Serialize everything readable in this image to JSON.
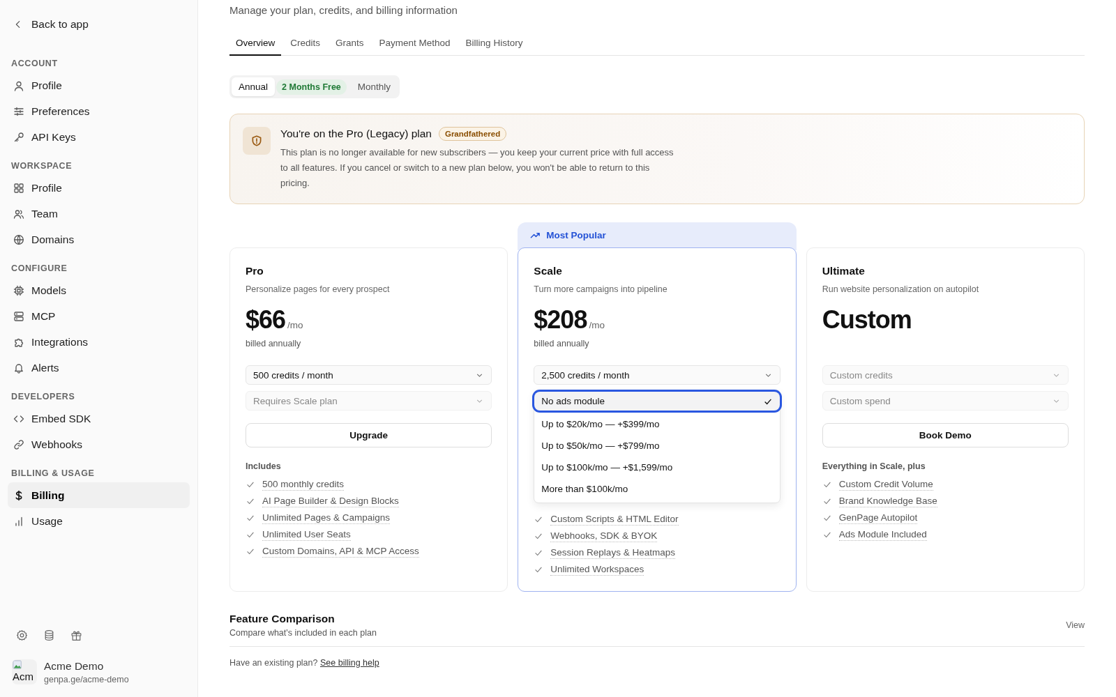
{
  "sidebar": {
    "back_link": "Back to app",
    "sections": [
      {
        "title": "ACCOUNT",
        "items": [
          {
            "label": "Profile",
            "selected": false
          },
          {
            "label": "Preferences",
            "selected": false
          },
          {
            "label": "API Keys",
            "selected": false
          }
        ]
      },
      {
        "title": "WORKSPACE",
        "items": [
          {
            "label": "Profile",
            "selected": false
          },
          {
            "label": "Team",
            "selected": false
          },
          {
            "label": "Domains",
            "selected": false
          }
        ]
      },
      {
        "title": "CONFIGURE",
        "items": [
          {
            "label": "Models",
            "selected": false
          },
          {
            "label": "MCP",
            "selected": false
          },
          {
            "label": "Integrations",
            "selected": false
          },
          {
            "label": "Alerts",
            "selected": false
          }
        ]
      },
      {
        "title": "DEVELOPERS",
        "items": [
          {
            "label": "Embed SDK",
            "selected": false
          },
          {
            "label": "Webhooks",
            "selected": false
          }
        ]
      },
      {
        "title": "BILLING & USAGE",
        "items": [
          {
            "label": "Billing",
            "selected": true
          },
          {
            "label": "Usage",
            "selected": false
          }
        ]
      }
    ],
    "account": {
      "avatar_alt": "Acm",
      "name": "Acme Demo",
      "url": "genpa.ge/acme-demo"
    }
  },
  "page": {
    "subtitle": "Manage your plan, credits, and billing information",
    "tabs": [
      {
        "label": "Overview",
        "selected": true
      },
      {
        "label": "Credits",
        "selected": false
      },
      {
        "label": "Grants",
        "selected": false
      },
      {
        "label": "Payment Method",
        "selected": false
      },
      {
        "label": "Billing History",
        "selected": false
      }
    ],
    "billing_toggle": [
      {
        "label": "Annual",
        "selected": true,
        "badge": "2 Months Free"
      },
      {
        "label": "Monthly",
        "selected": false
      }
    ],
    "notice": {
      "title": "You're on the Pro (Legacy) plan",
      "badge": "Grandfathered",
      "text": "This plan is no longer available for new subscribers — you keep your current price with full access to all features. If you cancel or switch to a new plan below, you won't be able to return to this pricing."
    },
    "plans": [
      {
        "name": "Pro",
        "tagline": "Personalize pages for every prospect",
        "price": "$66",
        "period": "/mo",
        "billing_note": "billed annually",
        "highlighted": false,
        "selects": [
          {
            "value": "500 credits / month",
            "disabled": false
          },
          {
            "placeholder": "Requires Scale plan",
            "disabled": true
          }
        ],
        "button": "Upgrade",
        "includes_title": "Includes",
        "features": [
          "500 monthly credits",
          "AI Page Builder & Design Blocks",
          "Unlimited Pages & Campaigns",
          "Unlimited User Seats",
          "Custom Domains, API & MCP Access"
        ]
      },
      {
        "name": "Scale",
        "tagline": "Turn more campaigns into pipeline",
        "price": "$208",
        "period": "/mo",
        "billing_note": "billed annually",
        "highlighted": true,
        "popular_label": "Most Popular",
        "selects": [
          {
            "value": "2,500 credits / month",
            "disabled": false
          }
        ],
        "menu": [
          {
            "label": "No ads module",
            "selected": true
          },
          {
            "label": "Up to $20k/mo — +$399/mo",
            "selected": false
          },
          {
            "label": "Up to $50k/mo — +$799/mo",
            "selected": false
          },
          {
            "label": "Up to $100k/mo — +$1,599/mo",
            "selected": false
          },
          {
            "label": "More than $100k/mo",
            "selected": false
          }
        ],
        "features": [
          "Custom Scripts & HTML Editor",
          "Webhooks, SDK & BYOK",
          "Session Replays & Heatmaps",
          "Unlimited Workspaces"
        ]
      },
      {
        "name": "Ultimate",
        "tagline": "Run website personalization on autopilot",
        "price": "Custom",
        "highlighted": false,
        "selects": [
          {
            "placeholder": "Custom credits",
            "disabled": true
          },
          {
            "placeholder": "Custom spend",
            "disabled": true
          }
        ],
        "button": "Book Demo",
        "includes_title": "Everything in Scale, plus",
        "features": [
          "Custom Credit Volume",
          "Brand Knowledge Base",
          "GenPage Autopilot",
          "Ads Module Included"
        ]
      }
    ],
    "comparison": {
      "title": "Feature Comparison",
      "subtitle": "Compare what's included in each plan",
      "link": "View"
    },
    "help": {
      "text": "Have an existing plan?",
      "link": "See billing help"
    }
  }
}
